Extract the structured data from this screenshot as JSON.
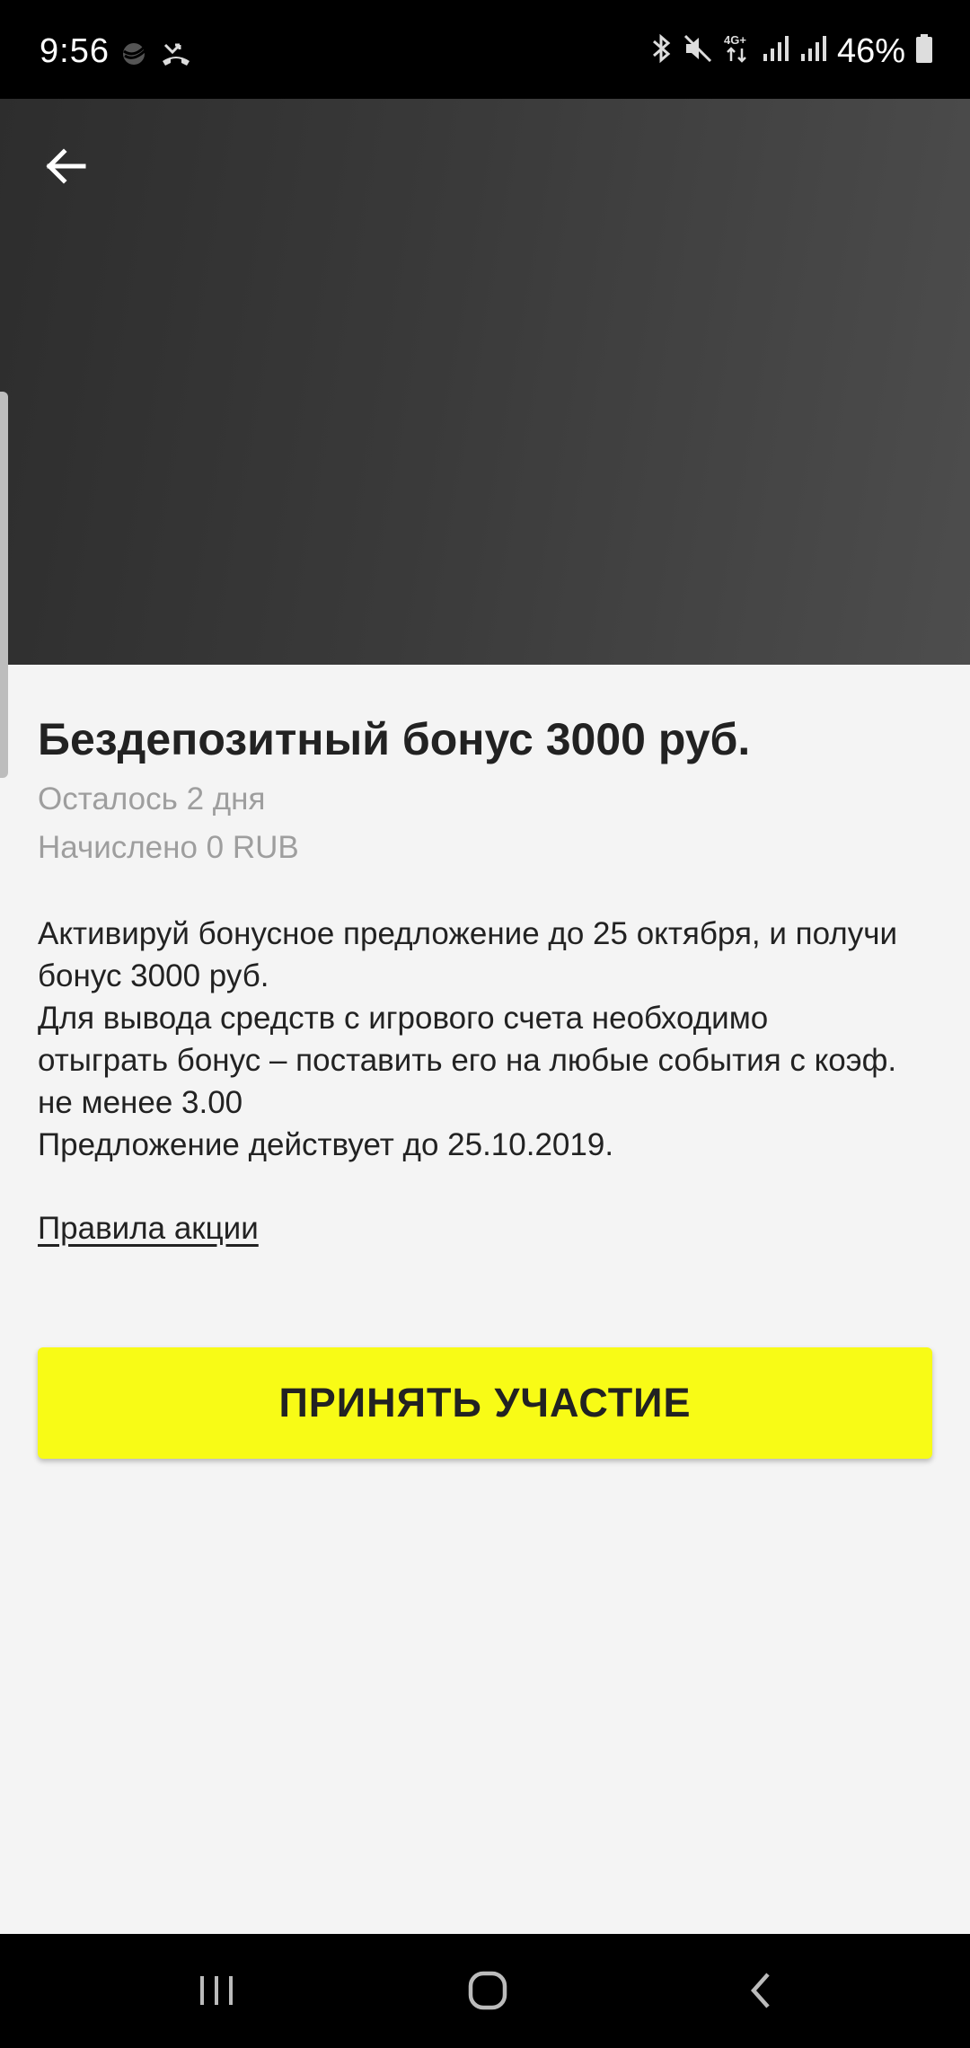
{
  "status_bar": {
    "time": "9:56",
    "battery_percent": "46%",
    "network": "4G+",
    "icons": [
      "sber-icon",
      "missed-call-icon",
      "bluetooth-icon",
      "mute-icon",
      "network-4g-icon",
      "signal-icon",
      "signal-icon",
      "battery-icon"
    ]
  },
  "header": {
    "back_icon": "arrow-left-icon"
  },
  "promo": {
    "title": "Бездепозитный бонус 3000 руб.",
    "days_left": "Осталось 2 дня",
    "credited": "Начислено 0 RUB",
    "description_lines": [
      "Активируй бонусное предложение до 25 октября, и получи",
      "бонус 3000 руб.",
      "Для вывода средств с игрового счета необходимо",
      "отыграть бонус – поставить его на любые события с коэф.",
      "не менее 3.00",
      "Предложение действует до 25.10.2019."
    ],
    "rules_link": "Правила акции",
    "cta_label": "ПРИНЯТЬ УЧАСТИЕ"
  },
  "colors": {
    "accent": "#f8fb16",
    "background": "#f4f4f4",
    "text": "#222222",
    "muted": "#9e9e9e"
  },
  "nav_bar": {
    "icons": [
      "recent-apps-icon",
      "home-icon",
      "back-icon"
    ]
  }
}
